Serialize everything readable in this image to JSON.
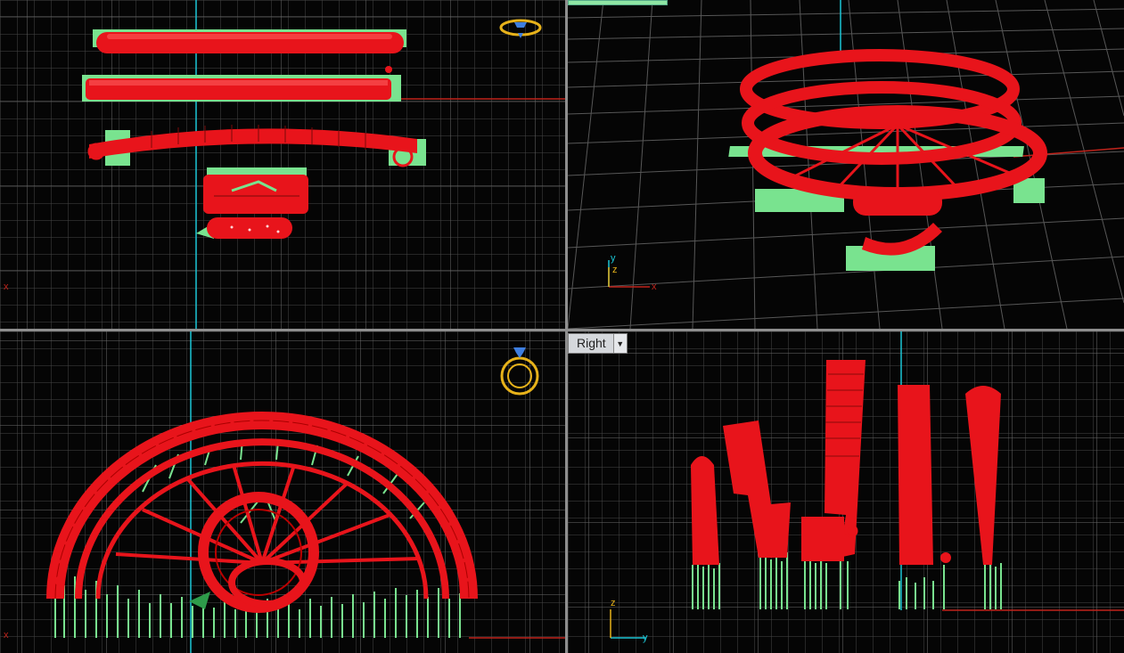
{
  "viewports": {
    "top_left": {
      "corner_axis_label": "x"
    },
    "top_right": {
      "axis_labels": {
        "x": "x",
        "y": "y",
        "z": "z"
      }
    },
    "bottom_left": {
      "corner_axis_label": "x"
    },
    "bottom_right": {
      "view_name": "Right",
      "dropdown_arrow": "▼",
      "axis_labels": {
        "y": "y",
        "z": "z"
      }
    }
  },
  "colors": {
    "grid": "#4a4a4a",
    "grid_major": "#6a6a6a",
    "model": "#e8141b",
    "support": "#79e38f",
    "axis_x": "#c0231b",
    "axis_y": "#1cc6d6",
    "ring_icon": "#e7b21a",
    "gem_icon": "#3f7fe0"
  },
  "icons": [
    "ring-gizmo-icon",
    "axis-triad-icon",
    "view-dropdown-icon"
  ]
}
